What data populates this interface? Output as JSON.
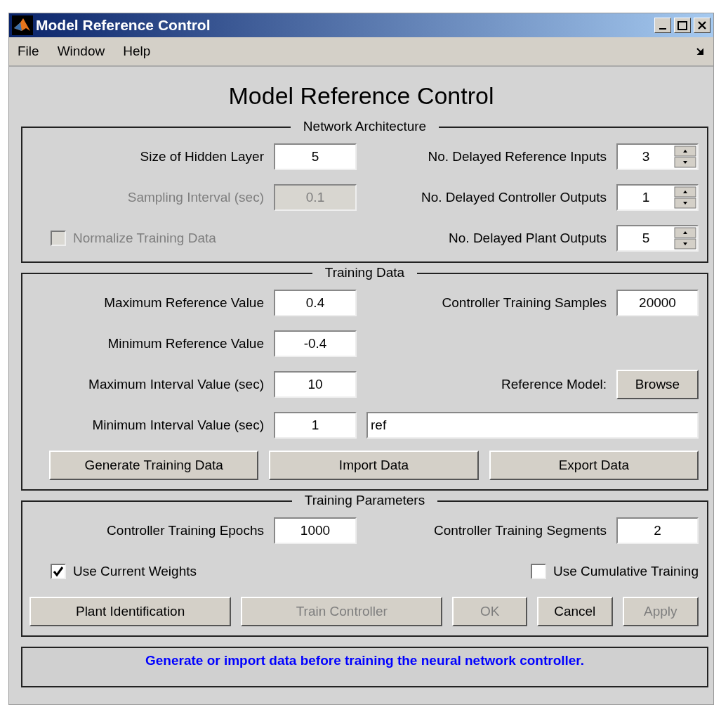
{
  "window": {
    "title": "Model Reference Control"
  },
  "menu": [
    "File",
    "Window",
    "Help"
  ],
  "heading": "Model Reference Control",
  "panels": [
    {
      "title": "Network Architecture",
      "rows": [
        {
          "left": {
            "kind": "field",
            "label": "Size of Hidden Layer",
            "value": "5",
            "disabled": false
          },
          "right": {
            "kind": "spinner",
            "label": "No. Delayed Reference Inputs",
            "value": "3",
            "disabled": false
          }
        },
        {
          "left": {
            "kind": "field",
            "label": "Sampling Interval (sec)",
            "value": "0.1",
            "disabled": true
          },
          "right": {
            "kind": "spinner",
            "label": "No. Delayed Controller Outputs",
            "value": "1",
            "disabled": false
          }
        },
        {
          "left": {
            "kind": "checkbox",
            "label": "Normalize Training Data",
            "checked": false,
            "disabled": true
          },
          "right": {
            "kind": "spinner",
            "label": "No. Delayed Plant Outputs",
            "value": "5",
            "disabled": false
          }
        }
      ]
    },
    {
      "title": "Training Data",
      "rows": [
        {
          "left": {
            "kind": "field",
            "label": "Maximum Reference Value",
            "value": "0.4",
            "disabled": false
          },
          "right": {
            "kind": "field",
            "label": "Controller Training Samples",
            "value": "20000",
            "disabled": false
          }
        },
        {
          "left": {
            "kind": "field",
            "label": "Minimum Reference Value",
            "value": "-0.4",
            "disabled": false
          }
        },
        {
          "left": {
            "kind": "field",
            "label": "Maximum Interval Value (sec)",
            "value": "10",
            "disabled": false
          },
          "right": {
            "kind": "button",
            "label": "Reference Model:",
            "button": "Browse",
            "disabled": false
          }
        },
        {
          "left": {
            "kind": "field",
            "label": "Minimum Interval Value (sec)",
            "value": "1",
            "disabled": false
          },
          "right": {
            "kind": "wide_field",
            "value": "ref"
          }
        }
      ],
      "buttons": [
        {
          "label": "Generate Training Data",
          "disabled": false
        },
        {
          "label": "Import Data",
          "disabled": false
        },
        {
          "label": "Export Data",
          "disabled": false
        }
      ]
    },
    {
      "title": "Training Parameters",
      "rows": [
        {
          "left": {
            "kind": "field",
            "label": "Controller Training Epochs",
            "value": "1000",
            "disabled": false
          },
          "right": {
            "kind": "field",
            "label": "Controller Training Segments",
            "value": "2",
            "disabled": false
          }
        },
        {
          "left": {
            "kind": "checkbox",
            "label": "Use Current Weights",
            "checked": true,
            "disabled": false
          },
          "right": {
            "kind": "checkbox",
            "label": "Use Cumulative Training",
            "checked": false,
            "disabled": false
          }
        }
      ],
      "buttons": [
        {
          "label": "Plant Identification",
          "disabled": false
        },
        {
          "label": "Train Controller",
          "disabled": true
        },
        {
          "label": "OK",
          "disabled": true
        },
        {
          "label": "Cancel",
          "disabled": false
        },
        {
          "label": "Apply",
          "disabled": true
        }
      ]
    }
  ],
  "status": "Generate or import data before training the neural network controller."
}
